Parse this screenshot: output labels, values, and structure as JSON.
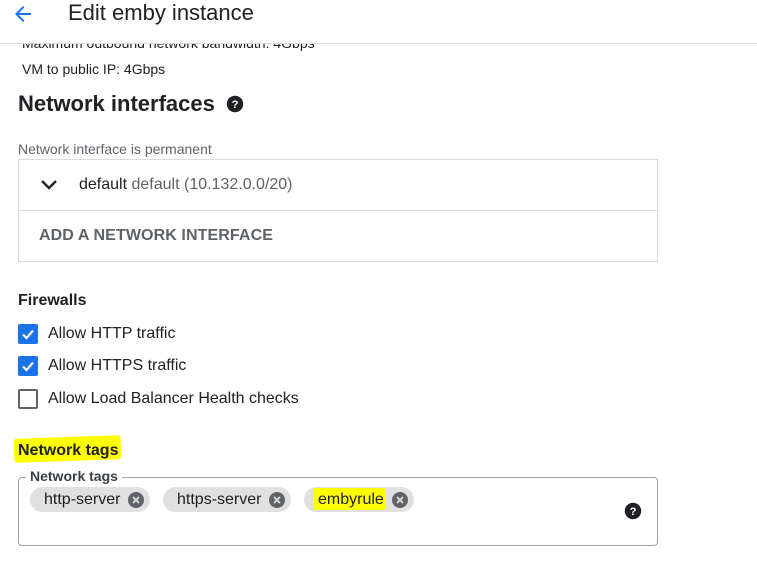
{
  "header": {
    "title": "Edit emby instance"
  },
  "network": {
    "clipped_text": "Maximum outbound network bandwidth: 4Gbps",
    "vm_public_ip": "VM to public IP: 4Gbps",
    "section_title": "Network interfaces",
    "permanent_note": "Network interface is permanent",
    "interface": {
      "name": "default",
      "detail": "default (10.132.0.0/20)"
    },
    "add_interface_label": "ADD A NETWORK INTERFACE"
  },
  "firewalls": {
    "title": "Firewalls",
    "options": [
      {
        "label": "Allow HTTP traffic",
        "checked": true
      },
      {
        "label": "Allow HTTPS traffic",
        "checked": true
      },
      {
        "label": "Allow Load Balancer Health checks",
        "checked": false
      }
    ]
  },
  "network_tags": {
    "title": "Network tags",
    "field_label": "Network tags",
    "tags": [
      "http-server",
      "https-server",
      "embyrule"
    ]
  },
  "colors": {
    "accent": "#1a73e8",
    "highlight": "#ffff00",
    "chip_bg": "#e0e0e0"
  }
}
